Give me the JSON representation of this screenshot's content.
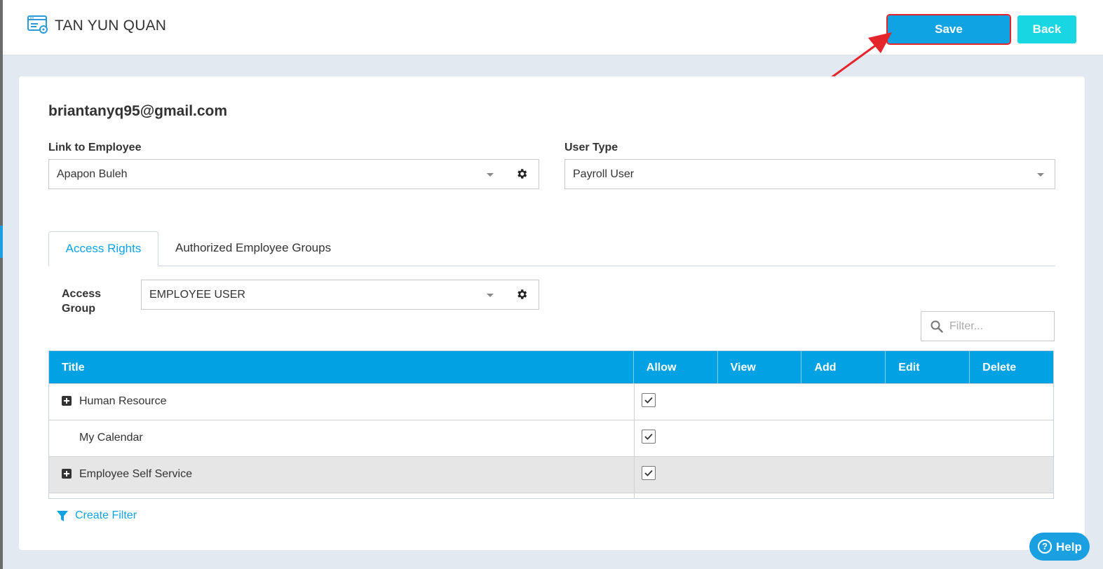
{
  "header": {
    "title": "TAN YUN QUAN",
    "save_label": "Save",
    "back_label": "Back"
  },
  "form": {
    "email": "briantanyq95@gmail.com",
    "link_employee_label": "Link to Employee",
    "link_employee_value": "Apapon Buleh",
    "user_type_label": "User Type",
    "user_type_value": "Payroll User"
  },
  "tabs": [
    {
      "label": "Access Rights",
      "active": true
    },
    {
      "label": "Authorized Employee Groups",
      "active": false
    }
  ],
  "access_group": {
    "label_line1": "Access",
    "label_line2": "Group",
    "value": "EMPLOYEE USER"
  },
  "filter": {
    "placeholder": "Filter..."
  },
  "table": {
    "columns": [
      "Title",
      "Allow",
      "View",
      "Add",
      "Edit",
      "Delete"
    ],
    "rows": [
      {
        "title": "Human Resource",
        "expandable": true,
        "allow": true
      },
      {
        "title": "My Calendar",
        "expandable": false,
        "allow": true
      },
      {
        "title": "Employee Self Service",
        "expandable": true,
        "allow": true
      }
    ]
  },
  "create_filter_label": "Create Filter",
  "help_label": "Help",
  "colors": {
    "primary": "#00a2e3",
    "save": "#0fa3e4",
    "back": "#18d6e2",
    "annotation": "#e4252c"
  },
  "icons": [
    "page-icon",
    "chevron-down-icon",
    "gear-icon",
    "search-icon",
    "plus-square-icon",
    "checkmark-icon",
    "funnel-icon",
    "question-icon",
    "arrow-annotation"
  ]
}
